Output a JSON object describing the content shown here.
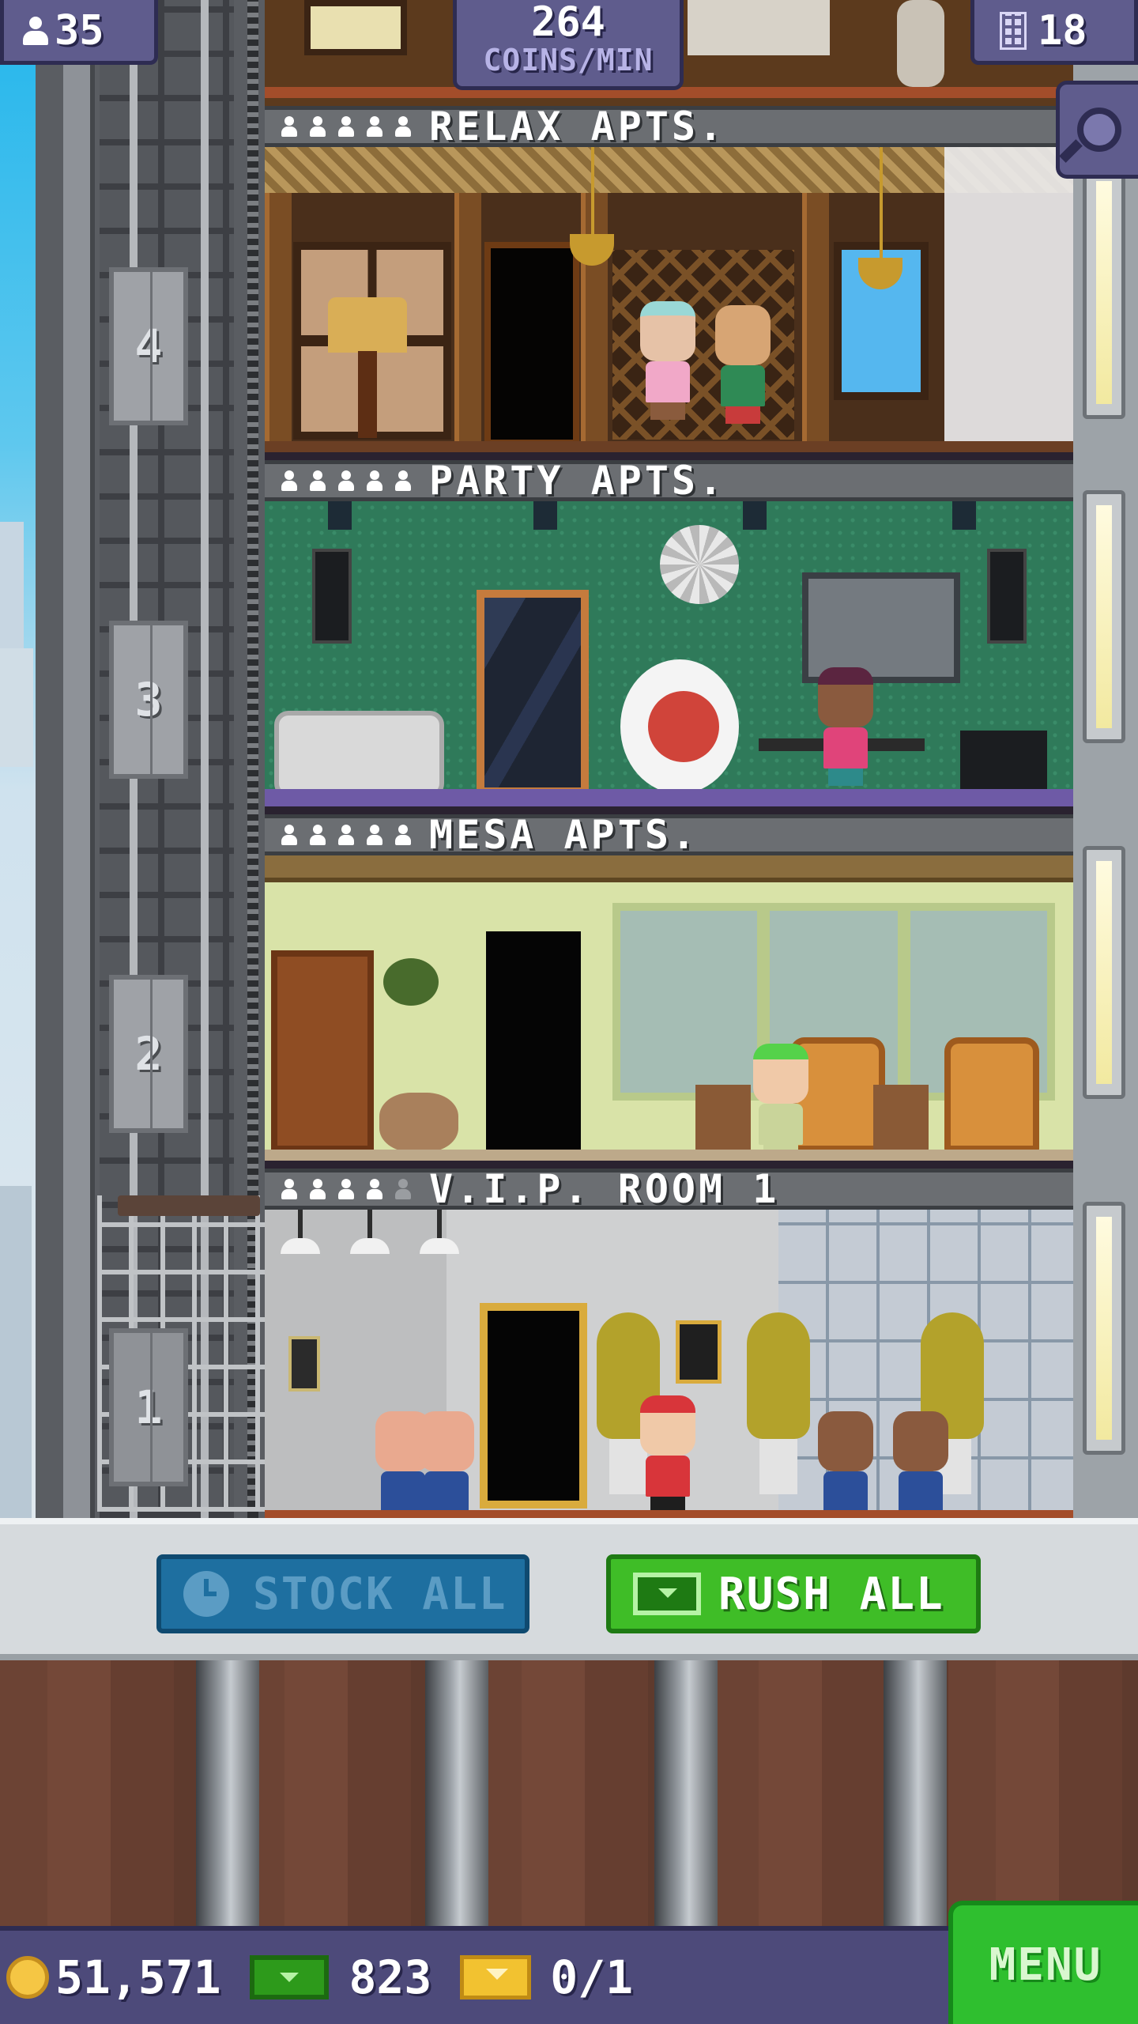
{
  "hud": {
    "population": "35",
    "coin_rate": "264",
    "coin_rate_unit": "COINS/MIN",
    "floors": "18",
    "search_icon": "magnifier-icon"
  },
  "elevator": {
    "floor_numbers": [
      "4",
      "3",
      "2",
      "1"
    ]
  },
  "floors": [
    {
      "name": "RELAX APTS.",
      "residents": 5,
      "capacity": 5
    },
    {
      "name": "PARTY APTS.",
      "residents": 5,
      "capacity": 5
    },
    {
      "name": "MESA APTS.",
      "residents": 5,
      "capacity": 5
    },
    {
      "name": "V.I.P. ROOM 1",
      "residents": 4,
      "capacity": 5
    }
  ],
  "actions": {
    "stock_all": "STOCK ALL",
    "rush_all": "RUSH ALL"
  },
  "currency": {
    "coins": "51,571",
    "bux": "823",
    "tickets": "0/1"
  },
  "menu_label": "MENU"
}
